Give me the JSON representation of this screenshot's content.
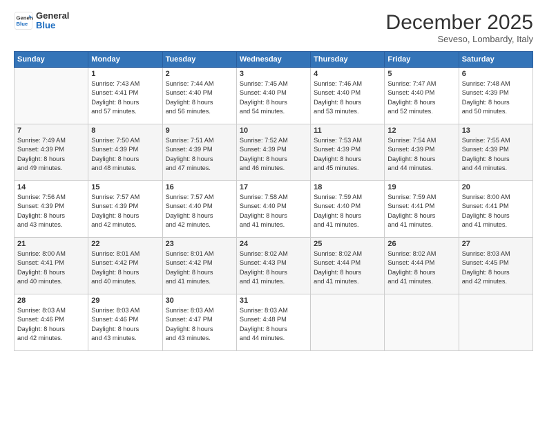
{
  "header": {
    "logo_general": "General",
    "logo_blue": "Blue",
    "month": "December 2025",
    "location": "Seveso, Lombardy, Italy"
  },
  "days_of_week": [
    "Sunday",
    "Monday",
    "Tuesday",
    "Wednesday",
    "Thursday",
    "Friday",
    "Saturday"
  ],
  "weeks": [
    [
      {
        "day": "",
        "content": ""
      },
      {
        "day": "1",
        "content": "Sunrise: 7:43 AM\nSunset: 4:41 PM\nDaylight: 8 hours\nand 57 minutes."
      },
      {
        "day": "2",
        "content": "Sunrise: 7:44 AM\nSunset: 4:40 PM\nDaylight: 8 hours\nand 56 minutes."
      },
      {
        "day": "3",
        "content": "Sunrise: 7:45 AM\nSunset: 4:40 PM\nDaylight: 8 hours\nand 54 minutes."
      },
      {
        "day": "4",
        "content": "Sunrise: 7:46 AM\nSunset: 4:40 PM\nDaylight: 8 hours\nand 53 minutes."
      },
      {
        "day": "5",
        "content": "Sunrise: 7:47 AM\nSunset: 4:40 PM\nDaylight: 8 hours\nand 52 minutes."
      },
      {
        "day": "6",
        "content": "Sunrise: 7:48 AM\nSunset: 4:39 PM\nDaylight: 8 hours\nand 50 minutes."
      }
    ],
    [
      {
        "day": "7",
        "content": "Sunrise: 7:49 AM\nSunset: 4:39 PM\nDaylight: 8 hours\nand 49 minutes."
      },
      {
        "day": "8",
        "content": "Sunrise: 7:50 AM\nSunset: 4:39 PM\nDaylight: 8 hours\nand 48 minutes."
      },
      {
        "day": "9",
        "content": "Sunrise: 7:51 AM\nSunset: 4:39 PM\nDaylight: 8 hours\nand 47 minutes."
      },
      {
        "day": "10",
        "content": "Sunrise: 7:52 AM\nSunset: 4:39 PM\nDaylight: 8 hours\nand 46 minutes."
      },
      {
        "day": "11",
        "content": "Sunrise: 7:53 AM\nSunset: 4:39 PM\nDaylight: 8 hours\nand 45 minutes."
      },
      {
        "day": "12",
        "content": "Sunrise: 7:54 AM\nSunset: 4:39 PM\nDaylight: 8 hours\nand 44 minutes."
      },
      {
        "day": "13",
        "content": "Sunrise: 7:55 AM\nSunset: 4:39 PM\nDaylight: 8 hours\nand 44 minutes."
      }
    ],
    [
      {
        "day": "14",
        "content": "Sunrise: 7:56 AM\nSunset: 4:39 PM\nDaylight: 8 hours\nand 43 minutes."
      },
      {
        "day": "15",
        "content": "Sunrise: 7:57 AM\nSunset: 4:39 PM\nDaylight: 8 hours\nand 42 minutes."
      },
      {
        "day": "16",
        "content": "Sunrise: 7:57 AM\nSunset: 4:40 PM\nDaylight: 8 hours\nand 42 minutes."
      },
      {
        "day": "17",
        "content": "Sunrise: 7:58 AM\nSunset: 4:40 PM\nDaylight: 8 hours\nand 41 minutes."
      },
      {
        "day": "18",
        "content": "Sunrise: 7:59 AM\nSunset: 4:40 PM\nDaylight: 8 hours\nand 41 minutes."
      },
      {
        "day": "19",
        "content": "Sunrise: 7:59 AM\nSunset: 4:41 PM\nDaylight: 8 hours\nand 41 minutes."
      },
      {
        "day": "20",
        "content": "Sunrise: 8:00 AM\nSunset: 4:41 PM\nDaylight: 8 hours\nand 41 minutes."
      }
    ],
    [
      {
        "day": "21",
        "content": "Sunrise: 8:00 AM\nSunset: 4:41 PM\nDaylight: 8 hours\nand 40 minutes."
      },
      {
        "day": "22",
        "content": "Sunrise: 8:01 AM\nSunset: 4:42 PM\nDaylight: 8 hours\nand 40 minutes."
      },
      {
        "day": "23",
        "content": "Sunrise: 8:01 AM\nSunset: 4:42 PM\nDaylight: 8 hours\nand 41 minutes."
      },
      {
        "day": "24",
        "content": "Sunrise: 8:02 AM\nSunset: 4:43 PM\nDaylight: 8 hours\nand 41 minutes."
      },
      {
        "day": "25",
        "content": "Sunrise: 8:02 AM\nSunset: 4:44 PM\nDaylight: 8 hours\nand 41 minutes."
      },
      {
        "day": "26",
        "content": "Sunrise: 8:02 AM\nSunset: 4:44 PM\nDaylight: 8 hours\nand 41 minutes."
      },
      {
        "day": "27",
        "content": "Sunrise: 8:03 AM\nSunset: 4:45 PM\nDaylight: 8 hours\nand 42 minutes."
      }
    ],
    [
      {
        "day": "28",
        "content": "Sunrise: 8:03 AM\nSunset: 4:46 PM\nDaylight: 8 hours\nand 42 minutes."
      },
      {
        "day": "29",
        "content": "Sunrise: 8:03 AM\nSunset: 4:46 PM\nDaylight: 8 hours\nand 43 minutes."
      },
      {
        "day": "30",
        "content": "Sunrise: 8:03 AM\nSunset: 4:47 PM\nDaylight: 8 hours\nand 43 minutes."
      },
      {
        "day": "31",
        "content": "Sunrise: 8:03 AM\nSunset: 4:48 PM\nDaylight: 8 hours\nand 44 minutes."
      },
      {
        "day": "",
        "content": ""
      },
      {
        "day": "",
        "content": ""
      },
      {
        "day": "",
        "content": ""
      }
    ]
  ]
}
